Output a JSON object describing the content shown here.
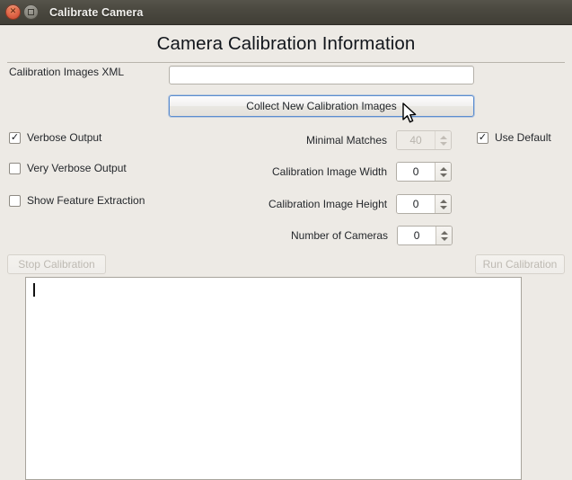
{
  "window": {
    "title": "Calibrate Camera",
    "close_icon": "close-icon",
    "maximize_icon": "maximize-icon"
  },
  "header": {
    "title": "Camera Calibration Information"
  },
  "fields": {
    "xml_label": "Calibration Images XML",
    "xml_value": "",
    "xml_placeholder": ""
  },
  "actions": {
    "collect_label": "Collect New Calibration Images",
    "stop_label": "Stop Calibration",
    "run_label": "Run Calibration"
  },
  "checkboxes": [
    {
      "label": "Verbose Output",
      "checked": true,
      "mark": "✓"
    },
    {
      "label": "Very Verbose Output",
      "checked": false,
      "mark": ""
    },
    {
      "label": "Show Feature Extraction",
      "checked": false,
      "mark": ""
    }
  ],
  "use_default": {
    "label": "Use Default",
    "checked": true,
    "mark": "✓"
  },
  "spinners": [
    {
      "label": "Minimal Matches",
      "value": "40",
      "enabled": false
    },
    {
      "label": "Calibration Image Width",
      "value": "0",
      "enabled": true
    },
    {
      "label": "Calibration Image Height",
      "value": "0",
      "enabled": true
    },
    {
      "label": "Number of Cameras",
      "value": "0",
      "enabled": true
    }
  ],
  "log": {
    "text": ""
  },
  "colors": {
    "window_bg": "#edeae5",
    "titlebar": "#4b4940",
    "close_button": "#e0674a",
    "focus_border": "#5b8dd0",
    "field_bg": "#ffffff",
    "disabled_text": "#bdb9b2"
  }
}
